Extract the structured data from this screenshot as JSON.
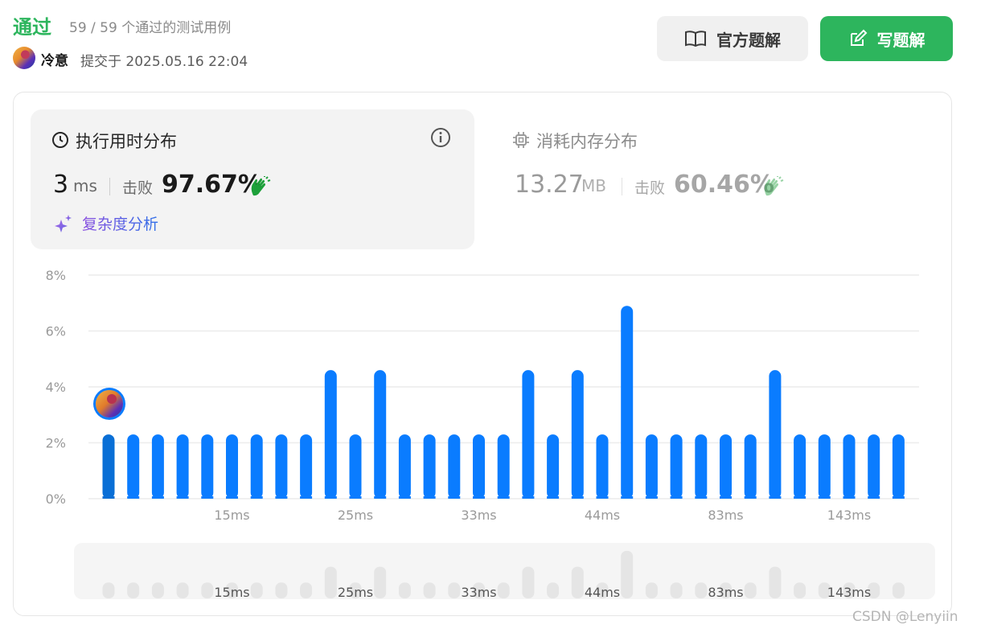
{
  "header": {
    "status": "通过",
    "case_count": "59 / 59 个通过的测试用例",
    "username": "冷意",
    "submit_label": "提交于 2025.05.16 22:04",
    "btn_official": "官方题解",
    "btn_write": "写题解"
  },
  "runtime": {
    "title": "执行用时分布",
    "value": "3",
    "unit": "ms",
    "beat_label": "击败",
    "beat_pct": "97.67%",
    "complexity_label": "复杂度分析"
  },
  "memory": {
    "title": "消耗内存分布",
    "value": "13.27",
    "unit": "MB",
    "beat_label": "击败",
    "beat_pct": "60.46%"
  },
  "colors": {
    "accent_green": "#2db55d",
    "bar_blue": "#0a7cff",
    "highlight_bar": "#0a6fd6",
    "nav_bar": "#e5e5e5"
  },
  "icons": {
    "book": "book-open-icon",
    "edit": "edit-pen-icon",
    "clock": "clock-icon",
    "info": "info-icon",
    "chip": "memory-chip-icon",
    "clap": "clapping-hands-icon",
    "sparkle": "sparkle-icon"
  },
  "chart_data": {
    "type": "bar",
    "y_unit": "%",
    "ylim": [
      0,
      8
    ],
    "yticks": [
      "0%",
      "2%",
      "4%",
      "6%",
      "8%"
    ],
    "x_tick_labels": [
      "15ms",
      "25ms",
      "33ms",
      "44ms",
      "83ms",
      "143ms"
    ],
    "x_tick_bar_index": [
      5,
      10,
      15,
      20,
      25,
      30
    ],
    "values": [
      2.3,
      2.3,
      2.3,
      2.3,
      2.3,
      2.3,
      2.3,
      2.3,
      2.3,
      4.6,
      2.3,
      4.6,
      2.3,
      2.3,
      2.3,
      2.3,
      2.3,
      4.6,
      2.3,
      4.6,
      2.3,
      6.9,
      2.3,
      2.3,
      2.3,
      2.3,
      2.3,
      4.6,
      2.3,
      2.3,
      2.3,
      2.3,
      2.3
    ],
    "highlight_bar_index": 0,
    "grid": true
  },
  "watermark": "CSDN @Lenyiin"
}
